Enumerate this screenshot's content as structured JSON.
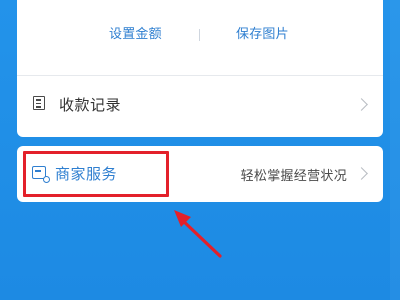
{
  "actions": {
    "set_amount_label": "设置金额",
    "save_image_label": "保存图片"
  },
  "record": {
    "label": "收款记录",
    "icon": "receipt-list-icon"
  },
  "merchant": {
    "label": "商家服务",
    "hint": "轻松掌握经营状况",
    "icon": "merchant-store-icon"
  },
  "annotation": {
    "box_color": "#e3202a",
    "arrow_color": "#e3202a"
  },
  "colors": {
    "background": "#1f8ee6",
    "accent": "#2f7fd0"
  }
}
